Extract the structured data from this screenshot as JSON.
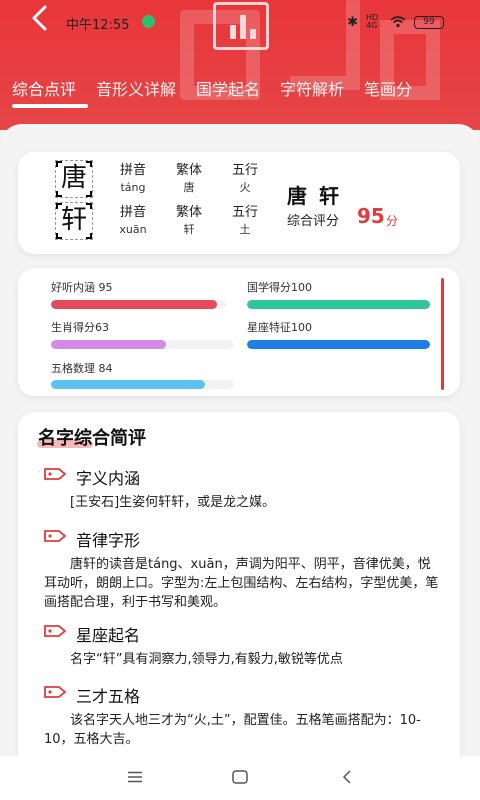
{
  "status": {
    "time": "中午12:55",
    "network": "HD 4G",
    "battery": "99"
  },
  "tabs": [
    "综合点评",
    "音形义详解",
    "国学起名",
    "字符解析",
    "笔画分"
  ],
  "name_card": {
    "chars": [
      {
        "char": "唐",
        "pinyin_label": "拼音",
        "pinyin": "táng",
        "trad_label": "繁体",
        "trad": "唐",
        "wuxing_label": "五行",
        "wuxing": "火"
      },
      {
        "char": "轩",
        "pinyin_label": "拼音",
        "pinyin": "xuān",
        "trad_label": "繁体",
        "trad": "轩",
        "wuxing_label": "五行",
        "wuxing": "土"
      }
    ],
    "full_name": "唐轩",
    "score_label": "综合评分",
    "score": "95",
    "score_unit": "分"
  },
  "scores": [
    {
      "label": "好听内涵 95",
      "value": 95,
      "color": "#e8485e"
    },
    {
      "label": "国学得分100",
      "value": 100,
      "color": "#2fc79a"
    },
    {
      "label": "生肖得分63",
      "value": 63,
      "color": "#d68ae8"
    },
    {
      "label": "星座特征100",
      "value": 100,
      "color": "#1f7ee6"
    },
    {
      "label": "五格数理 84",
      "value": 84,
      "color": "#5cc3f0"
    }
  ],
  "review": {
    "title": "名字综合简评",
    "sections": [
      {
        "title": "字义内涵",
        "text": "[王安石]生姿何轩轩，或是龙之媒。"
      },
      {
        "title": "音律字形",
        "text": "唐轩的读音是táng、xuān，声调为阳平、阴平，音律优美，悦耳动听，朗朗上口。字型为:左上包围结构、左右结构，字型优美，笔画搭配合理，利于书写和美观。"
      },
      {
        "title": "星座起名",
        "text": "名字“轩”具有洞察力,领导力,有毅力,敏锐等优点"
      },
      {
        "title": "三才五格",
        "text": "该名字天人地三才为“火,土”，配置佳。五格笔画搭配为：10-10，五格大吉。"
      }
    ]
  },
  "colors": {
    "primary": "#e8363a",
    "accent": "#e33b3b"
  },
  "icons": [
    "back-icon",
    "logo-chart-icon",
    "tag-icon",
    "menu-icon",
    "home-icon",
    "back-nav-icon"
  ]
}
